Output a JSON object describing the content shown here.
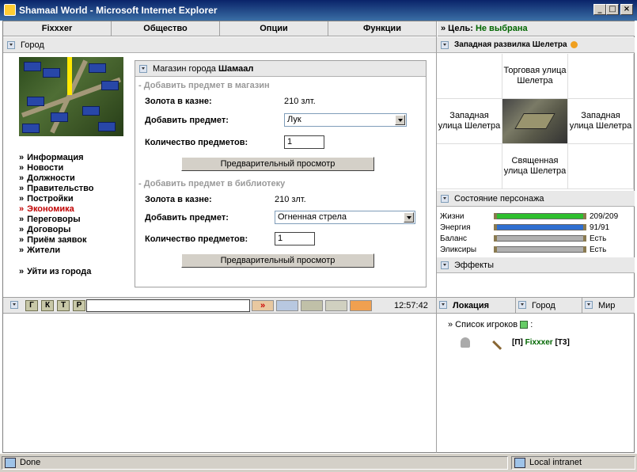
{
  "window": {
    "title": "Shamaal World - Microsoft Internet Explorer",
    "minimize": "_",
    "maximize": "□",
    "close": "×"
  },
  "topnav": [
    "Fixxxer",
    "Общество",
    "Опции",
    "Функции"
  ],
  "goal": {
    "label": "» Цель:",
    "value": "Не выбрана"
  },
  "city_panel": {
    "title": "Город"
  },
  "menu": [
    {
      "label": "Информация",
      "active": false
    },
    {
      "label": "Новости",
      "active": false
    },
    {
      "label": "Должности",
      "active": false
    },
    {
      "label": "Правительство",
      "active": false
    },
    {
      "label": "Постройки",
      "active": false
    },
    {
      "label": "Экономика",
      "active": true
    },
    {
      "label": "Переговоры",
      "active": false
    },
    {
      "label": "Договоры",
      "active": false
    },
    {
      "label": "Приём заявок",
      "active": false
    },
    {
      "label": "Жители",
      "active": false
    }
  ],
  "leave_city": "Уйти из города",
  "shop": {
    "title_prefix": "Магазин города",
    "title_city": "Шамаал",
    "section1": {
      "heading": "- Добавить предмет в магазин",
      "gold_label": "Золота в казне:",
      "gold_value": "210 злт.",
      "add_label": "Добавить предмет:",
      "item_value": "Лук",
      "qty_label": "Количество предметов:",
      "qty_value": "1",
      "preview_button": "Предварительный просмотр"
    },
    "section2": {
      "heading": "- Добавить предмет в библиотеку",
      "gold_label": "Золота в казне:",
      "gold_value": "210 злт.",
      "add_label": "Добавить предмет:",
      "item_value": "Огненная стрела",
      "qty_label": "Количество предметов:",
      "qty_value": "1",
      "preview_button": "Предварительный просмотр"
    }
  },
  "location": {
    "title": "Западная развилка Шелетра",
    "north": "Торговая улица Шелетра",
    "west": "Западная улица Шелетра",
    "east": "Западная улица Шелетра",
    "south": "Священная улица Шелетра"
  },
  "status": {
    "title": "Состояние персонажа",
    "rows": [
      {
        "name": "Жизни",
        "value": "209/209",
        "fill": 1.0,
        "color": "#2fbf2f"
      },
      {
        "name": "Энергия",
        "value": "91/91",
        "fill": 1.0,
        "color": "#2f6fd0"
      },
      {
        "name": "Баланс",
        "value": "Есть",
        "fill": 1.0,
        "color": "#b0b0b0"
      },
      {
        "name": "Эликсиры",
        "value": "Есть",
        "fill": 1.0,
        "color": "#b0b0b0"
      }
    ]
  },
  "effects": {
    "title": "Эффекты"
  },
  "chat": {
    "buttons": [
      "Г",
      "К",
      "Т",
      "Р"
    ],
    "send": "»",
    "time": "12:57:42"
  },
  "tabs": [
    "Локация",
    "Город",
    "Мир"
  ],
  "players": {
    "heading": "» Список игроков",
    "colon": ":",
    "tag": "[П]",
    "name": "Fixxxer",
    "rank": "[Т3]"
  },
  "statusbar": {
    "left": "Done",
    "right": "Local intranet"
  }
}
